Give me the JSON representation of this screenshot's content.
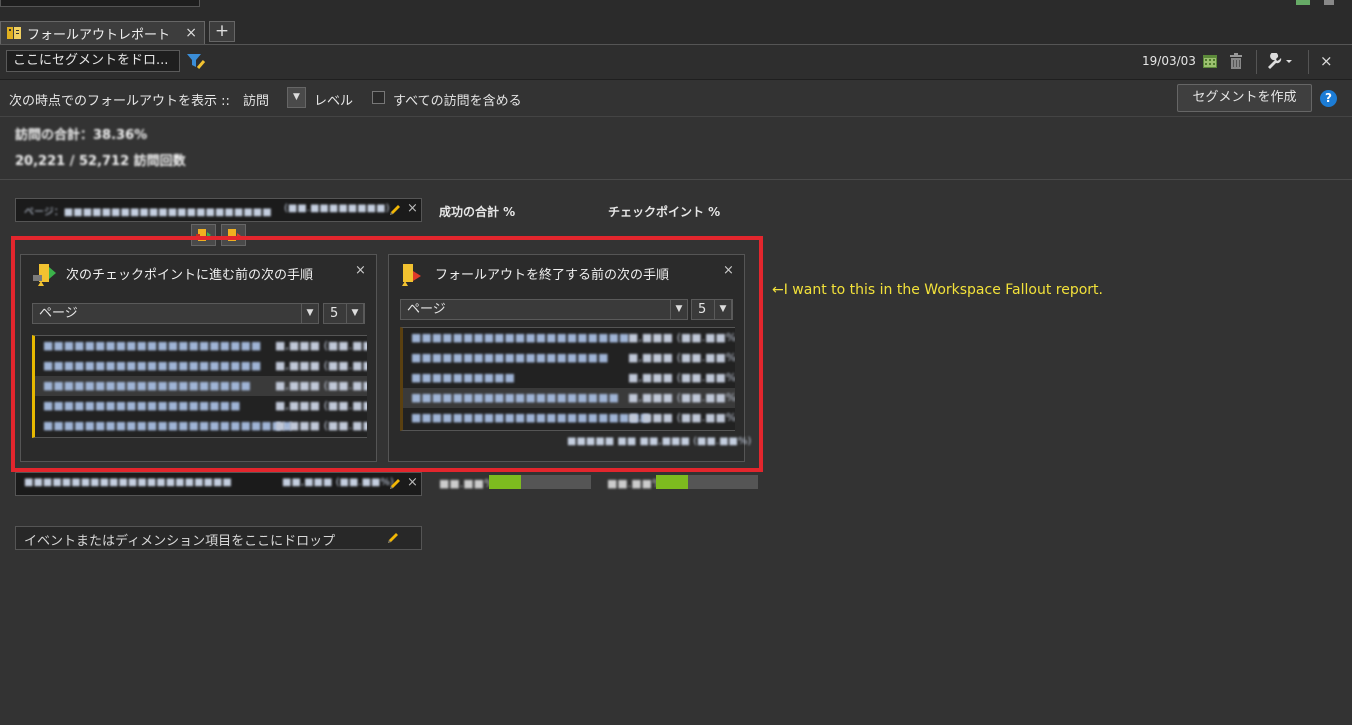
{
  "tab": {
    "label": "フォールアウトレポート",
    "close": "×",
    "add": "+"
  },
  "toolbar": {
    "segment_placeholder": "ここにセグメントをドロ...",
    "date": "19/03/03",
    "close": "×"
  },
  "options": {
    "show_label": "次の時点でのフォールアウトを表示 ::",
    "level_value": "訪問",
    "level_label": "レベル",
    "include_all_label": "すべての訪問を含める",
    "create_segment": "セグメントを作成",
    "help": "?"
  },
  "summary": {
    "line1": "訪問の合計：38.36%",
    "line2": "20,221 / 52,712 訪問回数"
  },
  "headers": {
    "success_total": "成功の合計 %",
    "checkpoint": "チェックポイント %"
  },
  "checkpoint1": {
    "label": "ページ：■■■■■■■■■■■■■■■■■■■■■■",
    "value": "(■■.■■■■■■■■)"
  },
  "panel_left": {
    "title": "次のチェックポイントに進む前の次の手順",
    "dimension": "ページ",
    "count": "5",
    "rows": [
      {
        "label": "■■■■■■■■■■■■■■■■■■■■■",
        "value": "■,■■■ (■■.■■%)"
      },
      {
        "label": "■■■■■■■■■■■■■■■■■■■■■",
        "value": "■,■■■ (■■.■■%)"
      },
      {
        "label": "■■■■■■■■■■■■■■■■■■■■",
        "value": "■,■■■ (■■.■■%)"
      },
      {
        "label": "■■■■■■■■■■■■■■■■■■■",
        "value": "■,■■■ (■■.■■%)"
      },
      {
        "label": "■■■■■■■■■■■■■■■■■■■■■■■■",
        "value": "■,■■■ (■■.■■%)"
      }
    ]
  },
  "panel_right": {
    "title": "フォールアウトを終了する前の次の手順",
    "dimension": "ページ",
    "count": "5",
    "rows": [
      {
        "label": "■■■■■■■■■■■■■■■■■■■■■",
        "value": "■,■■■ (■■.■■%)"
      },
      {
        "label": "■■■■■■■■■■■■■■■■■■■",
        "value": "■,■■■ (■■.■■%)"
      },
      {
        "label": "■■■■■■■■■■",
        "value": "■,■■■ (■■.■■%)"
      },
      {
        "label": "■■■■■■■■■■■■■■■■■■■■",
        "value": "■,■■■ (■■.■■%)"
      },
      {
        "label": "■■■■■■■■■■■■■■■■■■■■■■■",
        "value": "■,■■■ (■■.■■%)"
      }
    ],
    "footer": "■■■■■ ■■ ■■,■■■ (■■.■■%)"
  },
  "checkpoint2": {
    "label": "■■■■■■■■■■■■■■■■■■■■■■",
    "value": "■■,■■■ (■■.■■%)",
    "success_pct": "■■.■■%",
    "success_fraction": 0.31,
    "checkpoint_pct": "■■.■■%",
    "checkpoint_fraction": 0.31
  },
  "drop_zone": {
    "label": "イベントまたはディメンション項目をここにドロップ"
  },
  "annotation": "←I want to this in the Workspace Fallout report.",
  "colors": {
    "accent_yellow": "#f2e13a",
    "highlight_red": "#e3262d",
    "bar_green": "#7dbb1f",
    "help_blue": "#1c7cd5"
  }
}
